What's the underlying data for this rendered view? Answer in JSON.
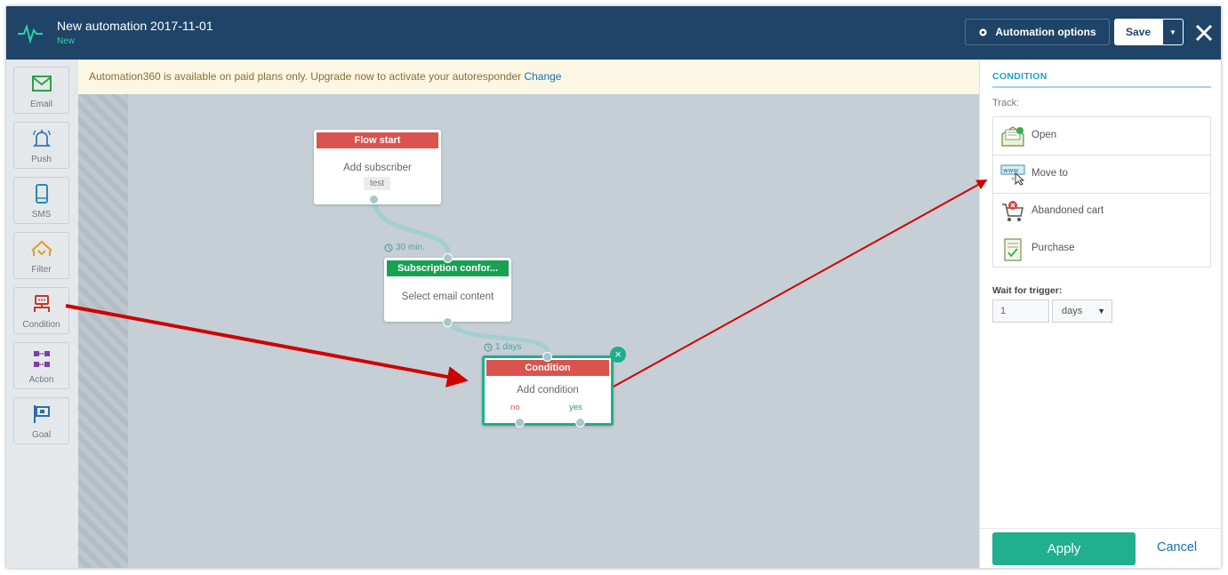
{
  "header": {
    "title": "New automation 2017-11-01",
    "subtitle": "New",
    "options_label": "Automation options",
    "save_label": "Save"
  },
  "toolbar": {
    "items": [
      {
        "label": "Email",
        "icon": "envelope-icon"
      },
      {
        "label": "Push",
        "icon": "bell-icon"
      },
      {
        "label": "SMS",
        "icon": "phone-icon"
      },
      {
        "label": "Filter",
        "icon": "filter-icon"
      },
      {
        "label": "Condition",
        "icon": "condition-icon"
      },
      {
        "label": "Action",
        "icon": "action-icon"
      },
      {
        "label": "Goal",
        "icon": "flag-icon"
      }
    ]
  },
  "notice": {
    "text": "Automation360 is available on paid plans only. Upgrade now to activate your autoresponder",
    "link": "Change"
  },
  "canvas": {
    "flow_start": {
      "title": "Flow start",
      "text": "Add subscriber",
      "tag": "test"
    },
    "delay1": "30 min.",
    "subscription": {
      "title": "Subscription confor...",
      "text": "Select email content"
    },
    "delay2": "1 days",
    "condition": {
      "title": "Condition",
      "text": "Add condition",
      "no": "no",
      "yes": "yes"
    }
  },
  "panel": {
    "title": "CONDITION",
    "track_label": "Track:",
    "track_items": [
      {
        "label": "Open",
        "icon": "open-envelope-icon"
      },
      {
        "label": "Move to",
        "icon": "move-to-icon"
      },
      {
        "label": "Abandoned cart",
        "icon": "abandoned-cart-icon"
      },
      {
        "label": "Purchase",
        "icon": "purchase-icon"
      }
    ],
    "wait_label": "Wait for trigger:",
    "wait_value": "1",
    "wait_unit": "days",
    "apply_label": "Apply",
    "cancel_label": "Cancel"
  },
  "colors": {
    "header": "#1f4468",
    "accent": "#1fae8a",
    "node_red": "#d9534f",
    "node_green": "#17a153",
    "annotation_arrow": "#d10000"
  }
}
